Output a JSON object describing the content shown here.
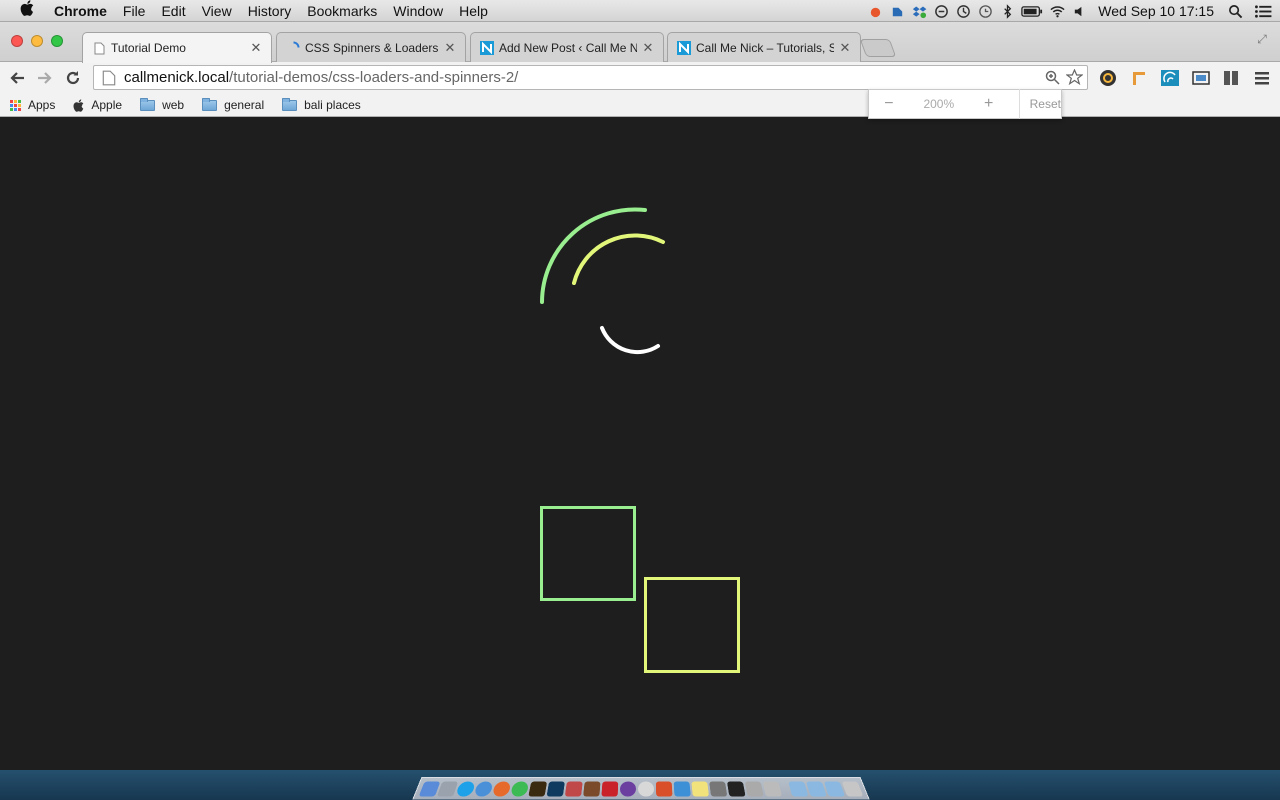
{
  "menubar": {
    "app_name": "Chrome",
    "menus": [
      "File",
      "Edit",
      "View",
      "History",
      "Bookmarks",
      "Window",
      "Help"
    ],
    "clock": "Wed Sep 10  17:15",
    "tray_icons": [
      "drop-icon",
      "evernote-icon",
      "dropbox-icon",
      "skype-icon",
      "sync-icon",
      "time-machine-icon",
      "bluetooth-icon",
      "battery-icon",
      "wifi-icon",
      "volume-icon",
      "spotlight-icon",
      "notification-center-icon"
    ]
  },
  "tabs": [
    {
      "title": "Tutorial Demo",
      "active": true,
      "favicon": "page-icon"
    },
    {
      "title": "CSS Spinners & Loaders – C",
      "active": false,
      "favicon": "loading-icon"
    },
    {
      "title": "Add New Post ‹ Call Me Nic",
      "active": false,
      "favicon": "callmenick-icon"
    },
    {
      "title": "Call Me Nick – Tutorials, St",
      "active": false,
      "favicon": "callmenick-icon"
    }
  ],
  "omnibox": {
    "host": "callmenick.local",
    "path": "/tutorial-demos/css-loaders-and-spinners-2/"
  },
  "bookmarks": [
    {
      "label": "Apps",
      "icon": "apps-icon"
    },
    {
      "label": "Apple",
      "icon": "apple-icon"
    },
    {
      "label": "web",
      "icon": "folder-icon"
    },
    {
      "label": "general",
      "icon": "folder-icon"
    },
    {
      "label": "bali places",
      "icon": "folder-icon"
    }
  ],
  "zoom_popup": {
    "minus": "−",
    "value": "200%",
    "plus": "+",
    "reset": "Reset"
  },
  "page": {
    "background": "#1e1e1e",
    "colors": {
      "green": "#99ef8f",
      "yellow_green": "#e2f77a",
      "white": "#ffffff"
    }
  }
}
